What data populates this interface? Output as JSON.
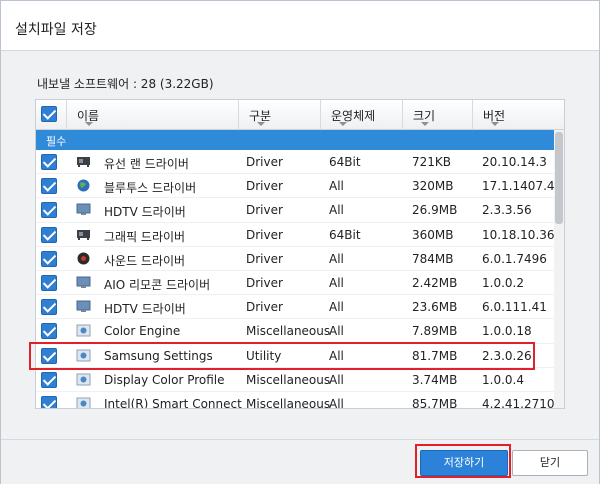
{
  "window": {
    "title": "설치파일 저장"
  },
  "summary": "내보낼 소프트웨어 : 28 (3.22GB)",
  "columns": [
    "이름",
    "구분",
    "운영체제",
    "크기",
    "버전"
  ],
  "group_label": "필수",
  "rows": [
    {
      "icon": "graphics-card-icon",
      "name": "유선 랜 드라이버",
      "type": "Driver",
      "os": "64Bit",
      "size": "721KB",
      "version": "20.10.14.3"
    },
    {
      "icon": "globe-icon",
      "name": "블루투스 드라이버",
      "type": "Driver",
      "os": "All",
      "size": "320MB",
      "version": "17.1.1407.4..."
    },
    {
      "icon": "monitor-icon",
      "name": "HDTV 드라이버",
      "type": "Driver",
      "os": "All",
      "size": "26.9MB",
      "version": "2.3.3.56"
    },
    {
      "icon": "graphics-card-icon",
      "name": "그래픽 드라이버",
      "type": "Driver",
      "os": "64Bit",
      "size": "360MB",
      "version": "10.18.10.36..."
    },
    {
      "icon": "speaker-icon",
      "name": "사운드 드라이버",
      "type": "Driver",
      "os": "All",
      "size": "784MB",
      "version": "6.0.1.7496"
    },
    {
      "icon": "monitor-icon",
      "name": "AIO 리모콘 드라이버",
      "type": "Driver",
      "os": "All",
      "size": "2.42MB",
      "version": "1.0.0.2"
    },
    {
      "icon": "monitor-icon",
      "name": "HDTV 드라이버",
      "type": "Driver",
      "os": "All",
      "size": "23.6MB",
      "version": "6.0.111.41"
    },
    {
      "icon": "app-icon",
      "name": "Color Engine",
      "type": "Miscellaneous",
      "os": "All",
      "size": "7.89MB",
      "version": "1.0.0.18"
    },
    {
      "icon": "app-icon",
      "name": "Samsung Settings",
      "type": "Utility",
      "os": "All",
      "size": "81.7MB",
      "version": "2.3.0.26"
    },
    {
      "icon": "app-icon",
      "name": "Display Color Profile",
      "type": "Miscellaneous",
      "os": "All",
      "size": "3.74MB",
      "version": "1.0.0.4"
    },
    {
      "icon": "app-icon",
      "name": "Intel(R) Smart Connect",
      "type": "Miscellaneous",
      "os": "All",
      "size": "85.7MB",
      "version": "4.2.41.2710"
    }
  ],
  "buttons": {
    "save": "저장하기",
    "close": "닫기"
  },
  "colors": {
    "accent": "#2f8ad8",
    "highlight": "#e0202a"
  }
}
